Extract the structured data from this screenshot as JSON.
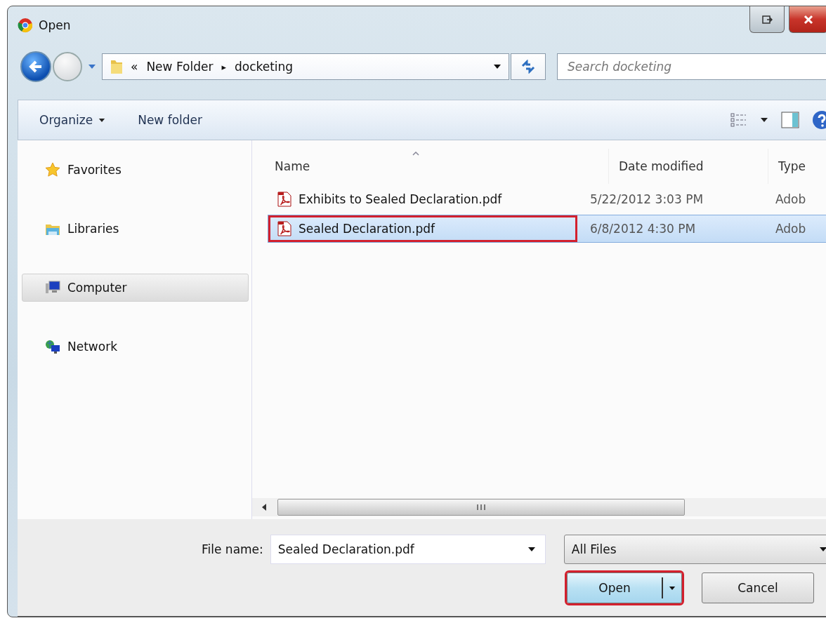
{
  "window": {
    "title": "Open"
  },
  "address": {
    "parts": [
      {
        "kind": "chevron",
        "text": "«"
      },
      {
        "kind": "folder",
        "text": "New Folder"
      },
      {
        "kind": "separator",
        "text": "▸"
      },
      {
        "kind": "folder",
        "text": "docketing"
      }
    ]
  },
  "search": {
    "placeholder": "Search docketing"
  },
  "toolbar": {
    "buttons": [
      {
        "label": "Organize",
        "dropdown": true
      },
      {
        "label": "New folder",
        "dropdown": false
      }
    ]
  },
  "sidebar": {
    "items": [
      {
        "label": "Favorites",
        "kind": "star",
        "selected": false
      },
      {
        "label": "Libraries",
        "kind": "library",
        "selected": false
      },
      {
        "label": "Computer",
        "kind": "computer",
        "selected": true
      },
      {
        "label": "Network",
        "kind": "network",
        "selected": false
      }
    ]
  },
  "table": {
    "columns": [
      "Name",
      "Date modified",
      "Type"
    ],
    "rows": [
      {
        "name": "Exhibits to Sealed Declaration.pdf",
        "date": "5/22/2012 3:03 PM",
        "type": "Adob",
        "selected": false,
        "highlighted": false
      },
      {
        "name": "Sealed Declaration.pdf",
        "date": "6/8/2012 4:30 PM",
        "type": "Adob",
        "selected": true,
        "highlighted": true
      }
    ]
  },
  "file_name": {
    "label": "File name:",
    "value": "Sealed Declaration.pdf"
  },
  "file_type": {
    "value": "All Files"
  },
  "buttons": [
    {
      "label": "Open",
      "kind": "split",
      "highlighted": true
    },
    {
      "label": "Cancel",
      "kind": "plain",
      "highlighted": false
    }
  ]
}
